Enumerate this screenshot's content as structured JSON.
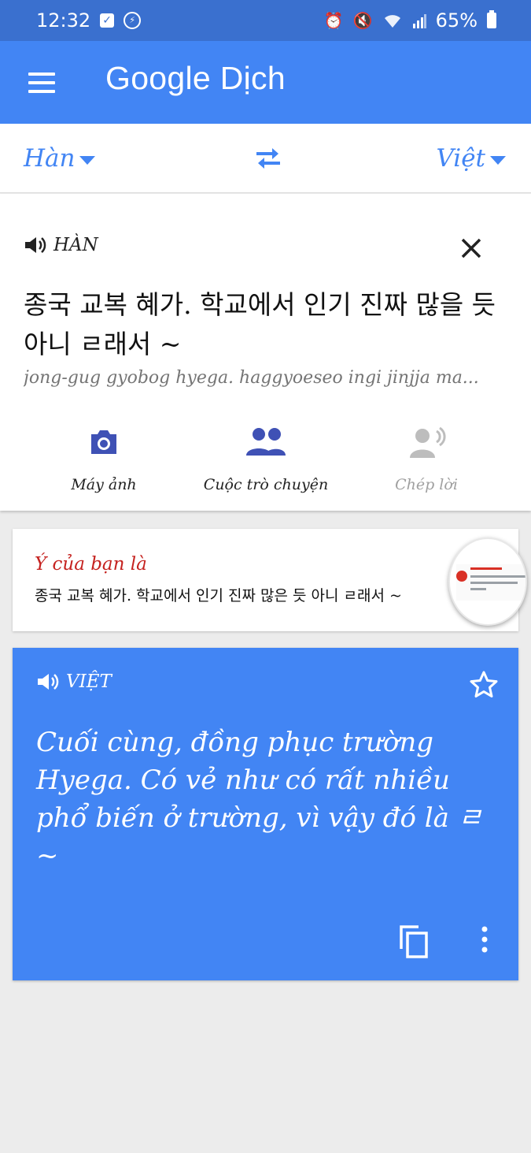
{
  "status_bar": {
    "time": "12:32",
    "battery": "65%",
    "icons": [
      "checkbox-icon",
      "messenger-icon",
      "alarm-icon",
      "mute-icon",
      "wifi-icon",
      "signal-icon",
      "battery-icon"
    ]
  },
  "app_bar": {
    "title": "Google Dịch"
  },
  "languages": {
    "source": "Hàn",
    "target": "Việt"
  },
  "input": {
    "label": "HÀN",
    "text": "종국 교복 혜가. 학교에서 인기 진짜 많을 듯 아니 ㄹ래서 ~",
    "romanization": "jong-gug gyobog hyega. haggyoeseo ingi jinjja ma..."
  },
  "tools": {
    "camera": "Máy ảnh",
    "conversation": "Cuộc trò chuyện",
    "transcribe": "Chép lời"
  },
  "suggestion": {
    "label": "Ý của bạn là",
    "text": "종국 교복 혜가. 학교에서 인기 진짜 많은 듯 아니 ㄹ래서 ~"
  },
  "output": {
    "label": "VIỆT",
    "text": "Cuối cùng, đồng phục trường Hyega.  Có vẻ như có rất nhiều phổ biến ở trường, vì vậy đó là ㄹ ~"
  },
  "colors": {
    "status_bar": "#3a70cf",
    "primary": "#4285f4",
    "suggest_label": "#c5221f",
    "background": "#ececec"
  }
}
